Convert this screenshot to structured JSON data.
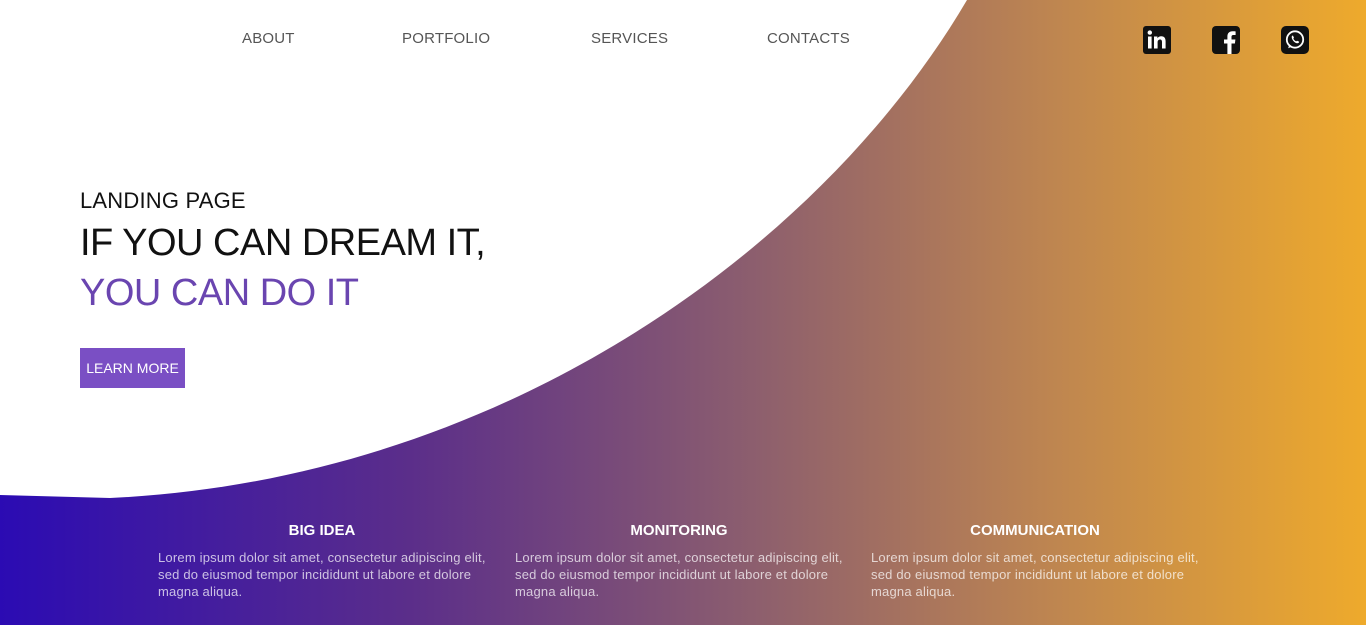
{
  "nav": {
    "links": [
      "ABOUT",
      "PORTFOLIO",
      "SERVICES",
      "CONTACTS"
    ]
  },
  "social": {
    "icons": [
      "linkedin-icon",
      "facebook-icon",
      "whatsapp-icon"
    ]
  },
  "hero": {
    "subtitle": "LANDING PAGE",
    "title_line1": "IF YOU CAN DREAM IT,",
    "title_line2": "YOU CAN DO IT",
    "button_label": "LEARN MORE"
  },
  "features": [
    {
      "title": "BIG IDEA",
      "text": "Lorem ipsum dolor sit amet, consectetur adipiscing elit, sed do eiusmod tempor incididunt ut labore et dolore magna aliqua."
    },
    {
      "title": "MONITORING",
      "text": "Lorem ipsum dolor sit amet, consectetur adipiscing elit, sed do eiusmod tempor incididunt ut labore et dolore magna aliqua."
    },
    {
      "title": "COMMUNICATION",
      "text": "Lorem ipsum dolor sit amet, consectetur adipiscing elit, sed do eiusmod tempor incididunt ut labore et dolore magna aliqua."
    }
  ],
  "colors": {
    "gradient_start": "#2b0bb3",
    "gradient_end": "#eeaa2c",
    "accent_purple": "#7a4fc4",
    "title_purple": "#6a45b0"
  }
}
